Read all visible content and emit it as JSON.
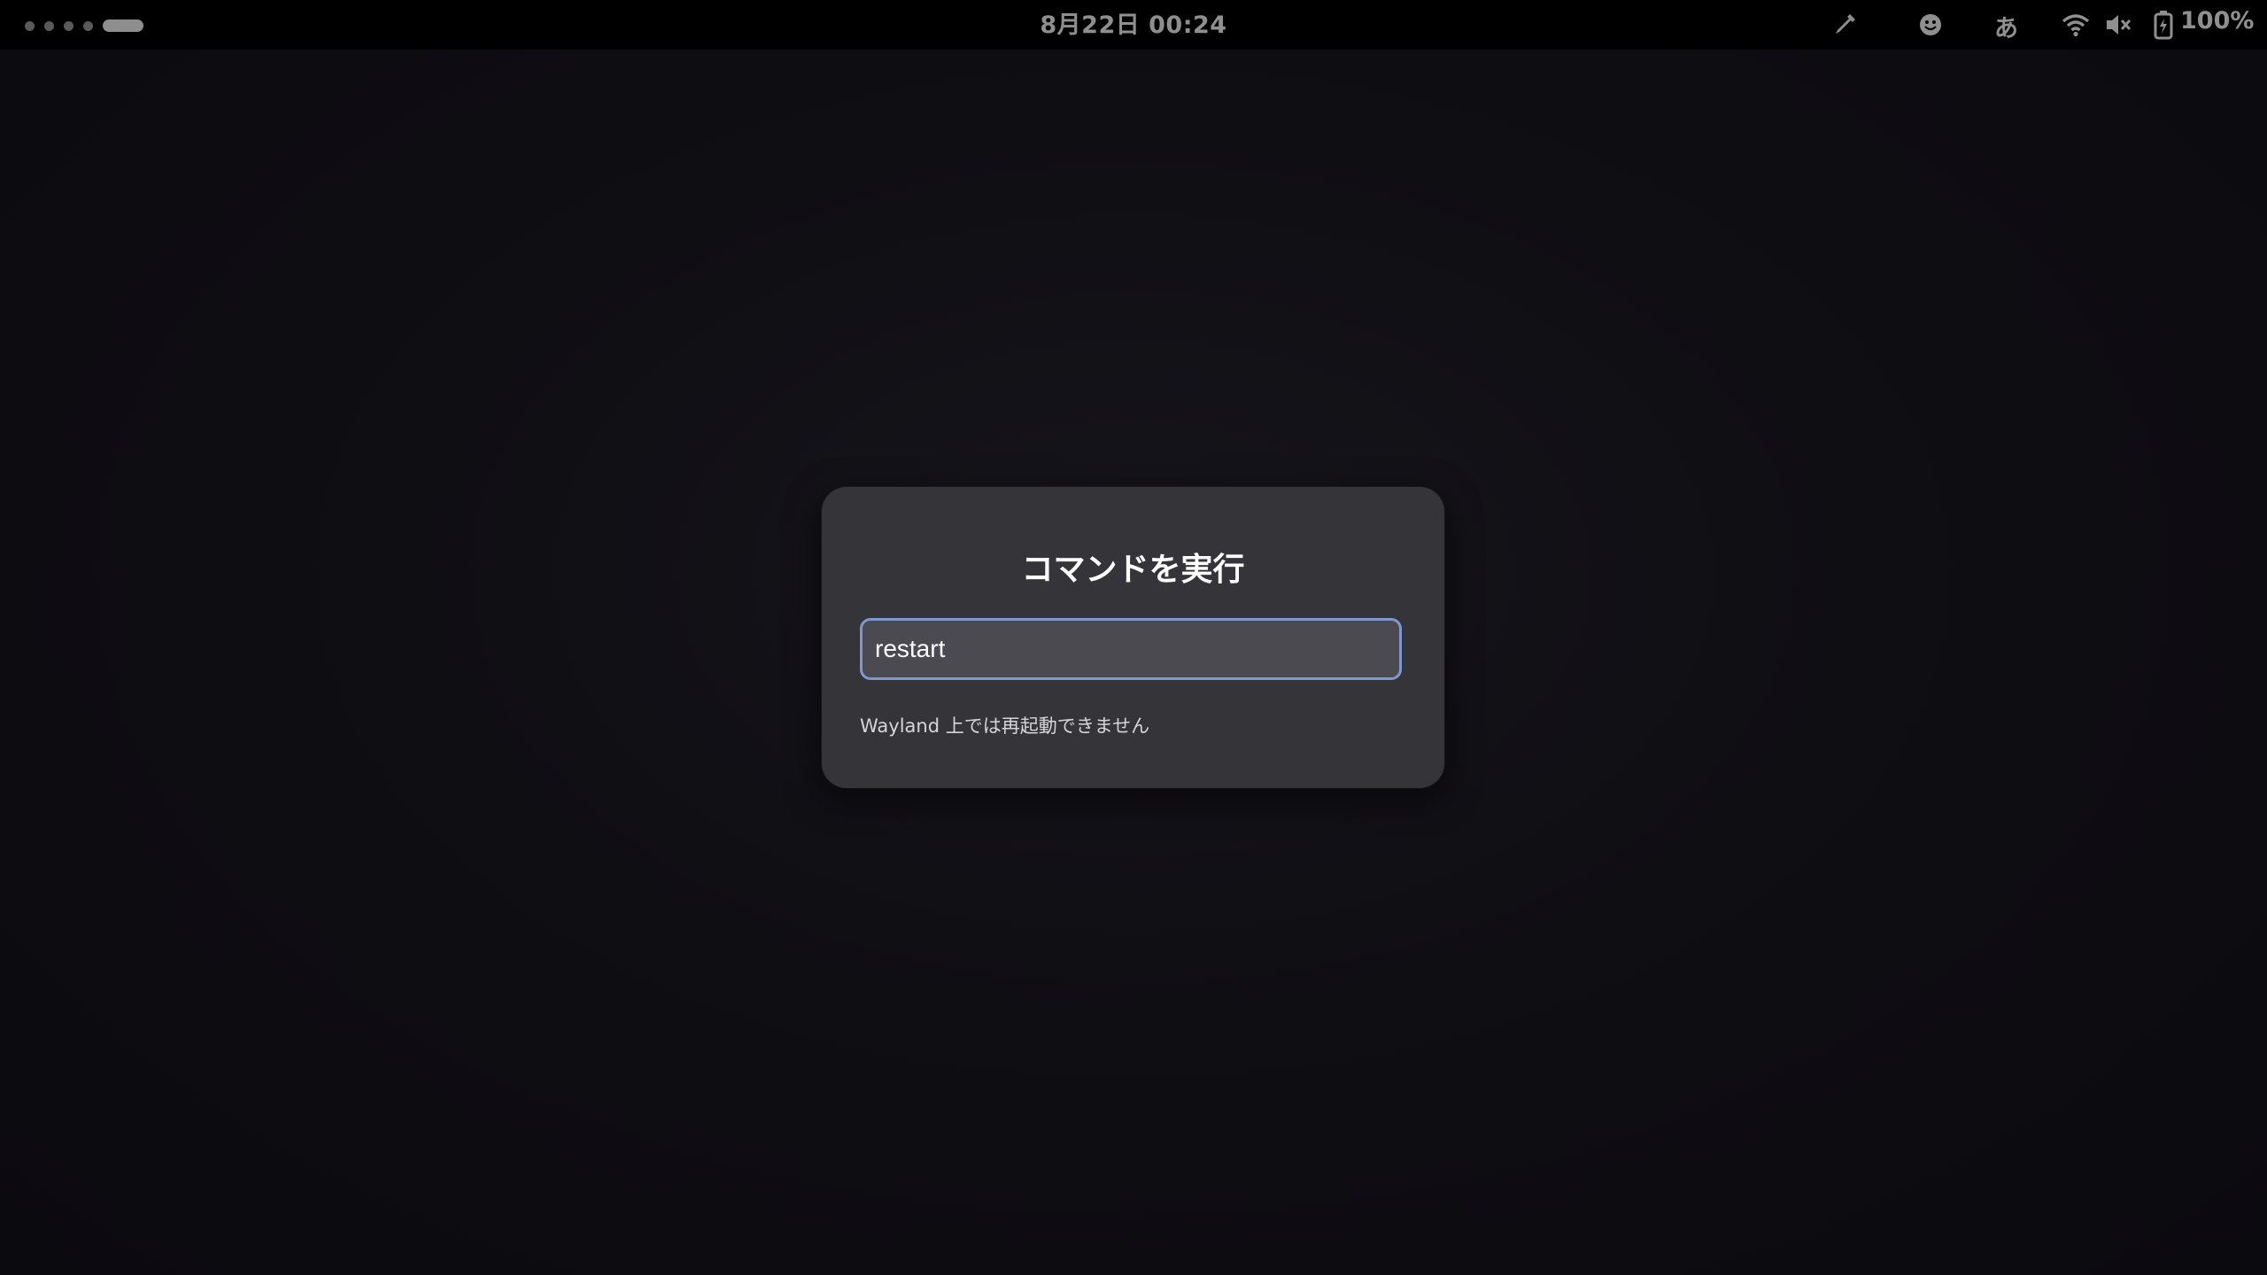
{
  "topbar": {
    "clock": "8月22日  00:24",
    "ime_indicator": "あ",
    "battery_percent": "100%",
    "icons": [
      "activities-workspace-indicator",
      "pipette-icon",
      "emoji-icon",
      "wifi-icon",
      "volume-muted-icon",
      "battery-icon"
    ]
  },
  "run_dialog": {
    "title": "コマンドを実行",
    "input_value": "restart",
    "message": "Wayland 上では再起動できません"
  },
  "colors": {
    "dialog_bg": "#353539",
    "input_border_focus": "#7d99d0",
    "topbar_bg": "#000000"
  }
}
